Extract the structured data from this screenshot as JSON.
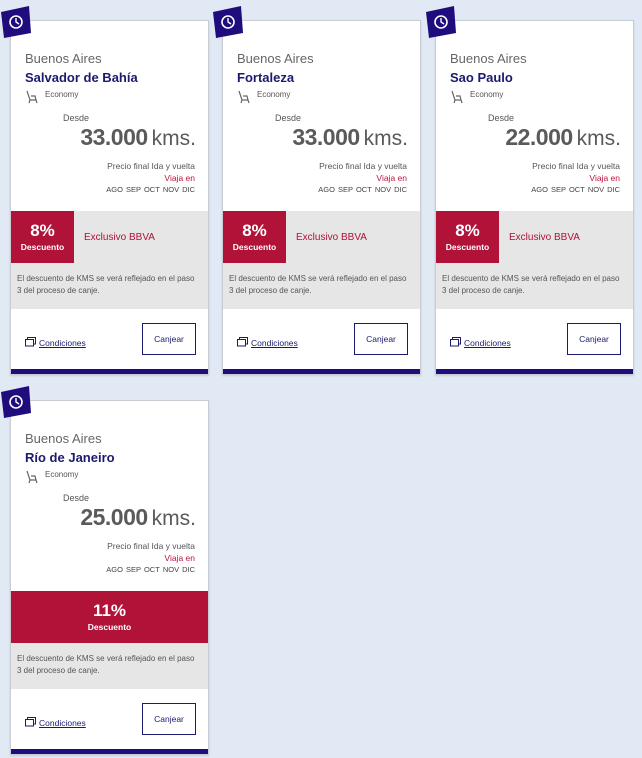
{
  "labels": {
    "desde": "Desde",
    "unit": "kms.",
    "precio_final": "Precio final Ida y vuelta",
    "viaja_en": "Viaja en",
    "descuento": "Descuento",
    "exclusivo": "Exclusivo BBVA",
    "note": "El descuento de KMS se verá reflejado en el paso 3 del proceso de canje.",
    "condiciones": "Condiciones",
    "canjear": "Canjear"
  },
  "months": [
    "AGO",
    "SEP",
    "OCT",
    "NOV",
    "DIC"
  ],
  "colors": {
    "accent_red": "#b01238",
    "navy": "#1a1a6e",
    "bar": "#1f0c7d",
    "page_bg": "#e1e9f4"
  },
  "icons": [
    "offer-badge-icon",
    "seat-icon",
    "document-icon"
  ],
  "cards": [
    {
      "origin": "Buenos Aires",
      "destination": "Salvador de Bahía",
      "cabin": "Economy",
      "price": "33.000",
      "discount": "8%",
      "exclusive": true
    },
    {
      "origin": "Buenos Aires",
      "destination": "Fortaleza",
      "cabin": "Economy",
      "price": "33.000",
      "discount": "8%",
      "exclusive": true
    },
    {
      "origin": "Buenos Aires",
      "destination": "Sao Paulo",
      "cabin": "Economy",
      "price": "22.000",
      "discount": "8%",
      "exclusive": true
    },
    {
      "origin": "Buenos Aires",
      "destination": "Río de Janeiro",
      "cabin": "Economy",
      "price": "25.000",
      "discount": "11%",
      "exclusive": false
    }
  ]
}
